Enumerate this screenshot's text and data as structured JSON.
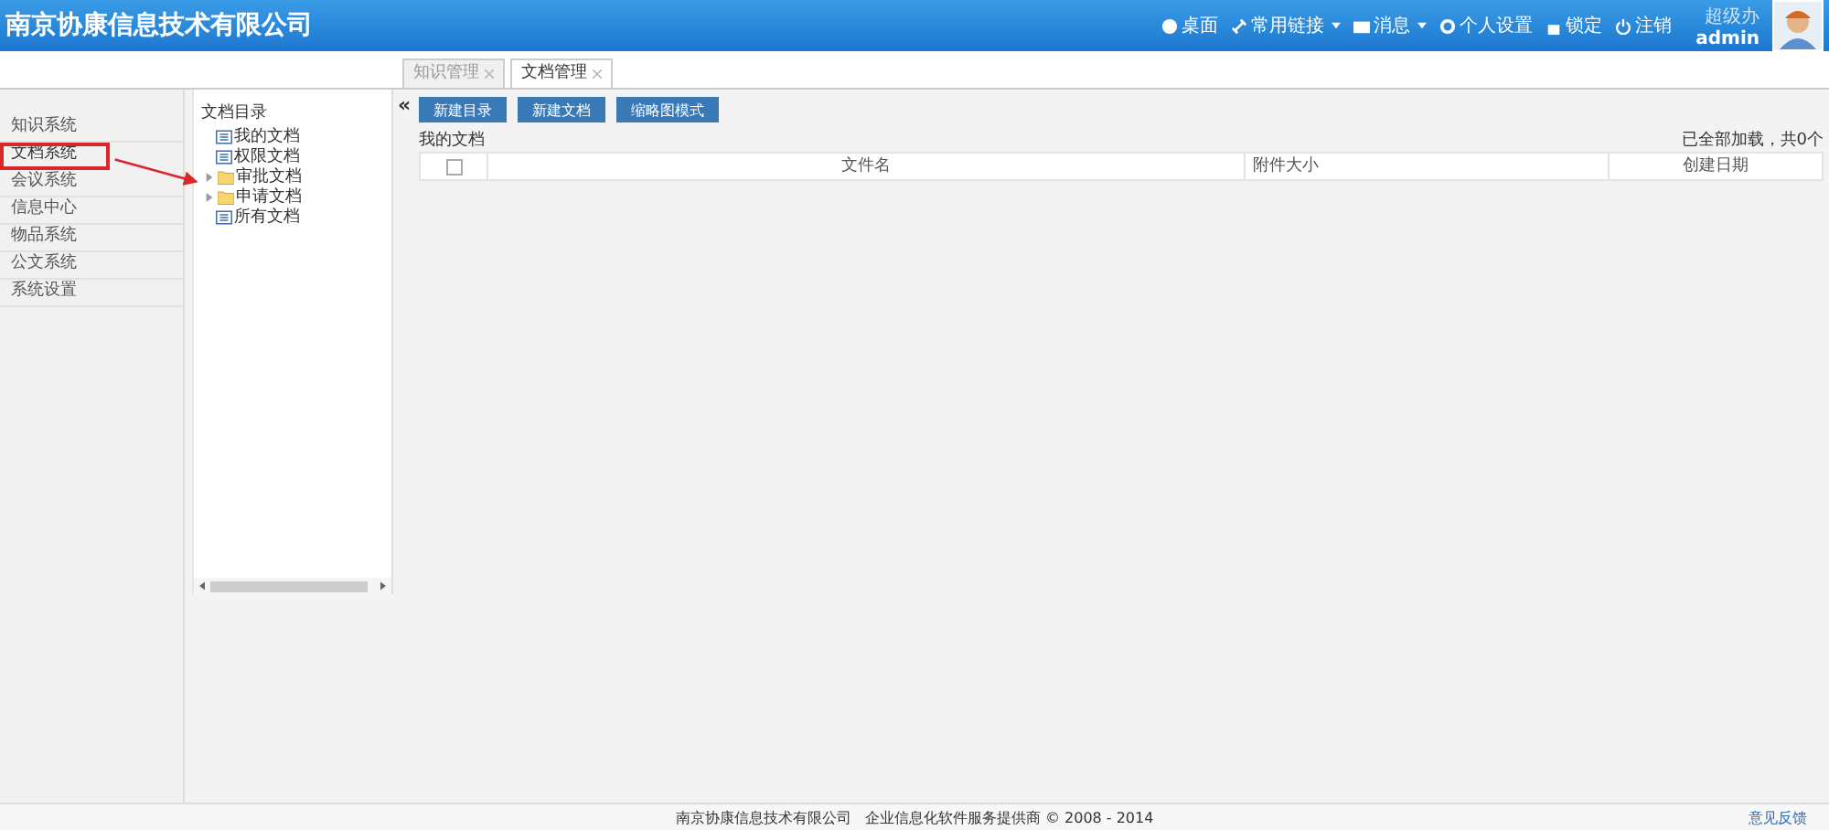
{
  "header": {
    "title": "南京协康信息技术有限公司",
    "menu": [
      {
        "label": "桌面",
        "kind": "home",
        "caret": false
      },
      {
        "label": "常用链接",
        "kind": "link",
        "caret": true
      },
      {
        "label": "消息",
        "kind": "mail",
        "caret": true
      },
      {
        "label": "个人设置",
        "kind": "gear",
        "caret": false
      },
      {
        "label": "锁定",
        "kind": "lock",
        "caret": false
      },
      {
        "label": "注销",
        "kind": "power",
        "caret": false
      }
    ],
    "user": {
      "role": "超级办",
      "name": "admin"
    }
  },
  "tabs": [
    {
      "label": "知识管理",
      "selected": false
    },
    {
      "label": "文档管理",
      "selected": true
    }
  ],
  "sidebar": {
    "items": [
      {
        "label": "知识系统",
        "selected": false
      },
      {
        "label": "文档系统",
        "selected": true
      },
      {
        "label": "会议系统",
        "selected": false
      },
      {
        "label": "信息中心",
        "selected": false
      },
      {
        "label": "物品系统",
        "selected": false
      },
      {
        "label": "公文系统",
        "selected": false
      },
      {
        "label": "系统设置",
        "selected": false
      }
    ]
  },
  "tree": {
    "title": "文档目录",
    "collapse": "«",
    "items": [
      {
        "label": "我的文档",
        "kind": "doc"
      },
      {
        "label": "权限文档",
        "kind": "doc"
      },
      {
        "label": "审批文档",
        "kind": "folder",
        "expanded": false
      },
      {
        "label": "申请文档",
        "kind": "folder",
        "expanded": false
      },
      {
        "label": "所有文档",
        "kind": "doc"
      }
    ]
  },
  "toolbar": {
    "buttons": [
      "新建目录",
      "新建文档",
      "缩略图模式"
    ]
  },
  "breadcrumb": "我的文档",
  "load_status": "已全部加载，共0个",
  "table": {
    "select_all_checked": false,
    "columns": [
      "文件名",
      "附件大小",
      "创建日期"
    ]
  },
  "footer": {
    "text": "南京协康信息技术有限公司   企业信息化软件服务提供商 © 2008 - 2014",
    "link": "意见反馈"
  }
}
